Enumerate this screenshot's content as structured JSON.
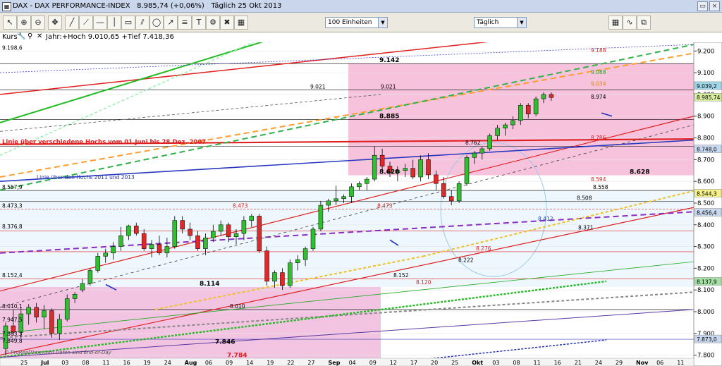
{
  "window": {
    "title": "DAX - DAX PERFORMANCE-INDEX",
    "quote": "8.985,74 (+0,06%)",
    "timeframe": "Täglich 25 Okt 2013"
  },
  "toolbar": {
    "units_select": "100 Einheiten",
    "period_select": "Täglich"
  },
  "header": {
    "series_label": "Kurs",
    "year_info": "Jahr:+Hoch 9.010,65 +Tief 7.418,36"
  },
  "chart_data": {
    "type": "candlestick",
    "ylim": [
      7750,
      9240
    ],
    "yticks": [
      "9.200",
      "9.100",
      "9.000",
      "8.900",
      "8.800",
      "8.700",
      "8.600",
      "8.500",
      "8.400",
      "8.300",
      "8.200",
      "8.100",
      "8.000",
      "7.900",
      "7.800"
    ],
    "xticks": [
      "25",
      "Jul",
      "03",
      "08",
      "11",
      "16",
      "19",
      "24",
      "Aug",
      "06",
      "09",
      "14",
      "19",
      "22",
      "27",
      "Sep",
      "04",
      "09",
      "12",
      "17",
      "20",
      "25",
      "Okt",
      "03",
      "08",
      "11",
      "16",
      "21",
      "24",
      "29",
      "Nov",
      "06",
      "11"
    ],
    "price_boxes": [
      {
        "label": "9.039,2",
        "value": 9039,
        "color": "#9fd6e8"
      },
      {
        "label": "8.985,74",
        "value": 8986,
        "color": "#d9f0a3"
      },
      {
        "label": "8.748,0",
        "value": 8748,
        "color": "#c8d8f0"
      },
      {
        "label": "8.544,3",
        "value": 8544,
        "color": "#f5f08a"
      },
      {
        "label": "8.456,4",
        "value": 8456,
        "color": "#c7d8ef"
      },
      {
        "label": "8.137,9",
        "value": 8138,
        "color": "#a6e0a6"
      },
      {
        "label": "7.873,0",
        "value": 7873,
        "color": "#c7d8ef"
      }
    ],
    "left_levels": [
      {
        "label": "9.198,6",
        "value": 9199
      },
      {
        "label": "8.557,9",
        "value": 8558
      },
      {
        "label": "8.473,3",
        "value": 8473
      },
      {
        "label": "8.376,8",
        "value": 8377
      },
      {
        "label": "8.152,4",
        "value": 8152
      },
      {
        "label": "8.010,1",
        "value": 8010
      },
      {
        "label": "7.947,5",
        "value": 7948
      },
      {
        "label": "7.883,3",
        "value": 7883
      },
      {
        "label": "7.849,8",
        "value": 7850
      }
    ],
    "level_labels": [
      {
        "label": "9.142",
        "value": 9142,
        "bold": true,
        "color": "#000"
      },
      {
        "label": "9.021",
        "value": 9021,
        "bold": false,
        "color": "#000"
      },
      {
        "label": "9.021",
        "value": 9021,
        "bold": false,
        "color": "#000"
      },
      {
        "label": "8.885",
        "value": 8885,
        "bold": true,
        "color": "#000"
      },
      {
        "label": "8.762",
        "value": 8762,
        "bold": false,
        "color": "#000"
      },
      {
        "label": "8.628",
        "value": 8628,
        "bold": true,
        "color": "#000"
      },
      {
        "label": "8.628",
        "value": 8628,
        "bold": true,
        "color": "#000"
      },
      {
        "label": "8.558",
        "value": 8558,
        "bold": false,
        "color": "#000"
      },
      {
        "label": "8.508",
        "value": 8508,
        "bold": false,
        "color": "#000"
      },
      {
        "label": "8.473",
        "value": 8473,
        "bold": false,
        "color": "#e02020"
      },
      {
        "label": "8.473",
        "value": 8473,
        "bold": false,
        "color": "#e02020"
      },
      {
        "label": "8.412",
        "value": 8412,
        "bold": false,
        "color": "#2040c0"
      },
      {
        "label": "8.371",
        "value": 8371,
        "bold": false,
        "color": "#000"
      },
      {
        "label": "8.276",
        "value": 8276,
        "bold": false,
        "color": "#e02020"
      },
      {
        "label": "8.222",
        "value": 8222,
        "bold": false,
        "color": "#000"
      },
      {
        "label": "8.152",
        "value": 8152,
        "bold": false,
        "color": "#000"
      },
      {
        "label": "8.120",
        "value": 8120,
        "bold": false,
        "color": "#e02020"
      },
      {
        "label": "8.114",
        "value": 8114,
        "bold": true,
        "color": "#000"
      },
      {
        "label": "8.010",
        "value": 8010,
        "bold": false,
        "color": "#000"
      },
      {
        "label": "7.846",
        "value": 7846,
        "bold": true,
        "color": "#000"
      },
      {
        "label": "7.784",
        "value": 7784,
        "bold": true,
        "color": "#e02020"
      },
      {
        "label": "9.188",
        "value": 9188,
        "bold": false,
        "color": "#e02020"
      },
      {
        "label": "9.088",
        "value": 9088,
        "bold": false,
        "color": "#22aa22"
      },
      {
        "label": "9.034",
        "value": 9034,
        "bold": false,
        "color": "#e08a00"
      },
      {
        "label": "8.974",
        "value": 8974,
        "bold": false,
        "color": "#000"
      },
      {
        "label": "8.786",
        "value": 8786,
        "bold": false,
        "color": "#e02020"
      },
      {
        "label": "8.594",
        "value": 8594,
        "bold": false,
        "color": "#e02020"
      }
    ],
    "annotations": [
      "Linie über verschiedene Hochs vom 01.Juni bis 28.Dez. 2007",
      "Linie über den Hochs 2011 und 2013"
    ],
    "footer_credit": "© ProRealTime.com Daten sind End-of-Day",
    "candles": [
      [
        7830,
        7950,
        7800,
        7935
      ],
      [
        7935,
        8010,
        7890,
        7905
      ],
      [
        7905,
        8020,
        7880,
        7990
      ],
      [
        7990,
        8035,
        7940,
        8020
      ],
      [
        8020,
        8040,
        7950,
        7975
      ],
      [
        7975,
        8030,
        7920,
        8005
      ],
      [
        8005,
        8015,
        7880,
        7900
      ],
      [
        7900,
        7990,
        7870,
        7965
      ],
      [
        7965,
        8080,
        7955,
        8060
      ],
      [
        8060,
        8090,
        8040,
        8080
      ],
      [
        8100,
        8150,
        8090,
        8130
      ],
      [
        8130,
        8200,
        8120,
        8190
      ],
      [
        8190,
        8270,
        8180,
        8255
      ],
      [
        8255,
        8290,
        8225,
        8270
      ],
      [
        8270,
        8320,
        8240,
        8300
      ],
      [
        8300,
        8390,
        8280,
        8350
      ],
      [
        8350,
        8400,
        8330,
        8395
      ],
      [
        8395,
        8410,
        8350,
        8360
      ],
      [
        8360,
        8380,
        8280,
        8290
      ],
      [
        8290,
        8330,
        8250,
        8310
      ],
      [
        8310,
        8350,
        8260,
        8270
      ],
      [
        8270,
        8340,
        8250,
        8300
      ],
      [
        8300,
        8440,
        8290,
        8420
      ],
      [
        8420,
        8440,
        8360,
        8380
      ],
      [
        8380,
        8410,
        8330,
        8350
      ],
      [
        8350,
        8370,
        8280,
        8290
      ],
      [
        8290,
        8360,
        8260,
        8340
      ],
      [
        8340,
        8400,
        8320,
        8370
      ],
      [
        8370,
        8420,
        8350,
        8400
      ],
      [
        8400,
        8410,
        8320,
        8345
      ],
      [
        8345,
        8380,
        8310,
        8360
      ],
      [
        8360,
        8440,
        8330,
        8420
      ],
      [
        8420,
        8450,
        8390,
        8440
      ],
      [
        8440,
        8450,
        8270,
        8280
      ],
      [
        8280,
        8300,
        8120,
        8140
      ],
      [
        8140,
        8190,
        8110,
        8180
      ],
      [
        8180,
        8200,
        8100,
        8120
      ],
      [
        8120,
        8240,
        8110,
        8225
      ],
      [
        8225,
        8260,
        8190,
        8240
      ],
      [
        8240,
        8300,
        8210,
        8290
      ],
      [
        8290,
        8390,
        8280,
        8380
      ],
      [
        8380,
        8510,
        8370,
        8490
      ],
      [
        8490,
        8520,
        8460,
        8510
      ],
      [
        8510,
        8580,
        8490,
        8520
      ],
      [
        8520,
        8540,
        8500,
        8530
      ],
      [
        8530,
        8590,
        8500,
        8575
      ],
      [
        8575,
        8600,
        8560,
        8590
      ],
      [
        8590,
        8620,
        8560,
        8610
      ],
      [
        8610,
        8760,
        8600,
        8720
      ],
      [
        8720,
        8750,
        8650,
        8670
      ],
      [
        8670,
        8690,
        8620,
        8640
      ],
      [
        8640,
        8670,
        8600,
        8650
      ],
      [
        8650,
        8680,
        8620,
        8660
      ],
      [
        8660,
        8700,
        8610,
        8620
      ],
      [
        8620,
        8720,
        8600,
        8700
      ],
      [
        8700,
        8730,
        8610,
        8630
      ],
      [
        8630,
        8650,
        8560,
        8590
      ],
      [
        8590,
        8620,
        8520,
        8530
      ],
      [
        8530,
        8560,
        8490,
        8510
      ],
      [
        8510,
        8600,
        8500,
        8590
      ],
      [
        8590,
        8720,
        8580,
        8710
      ],
      [
        8710,
        8740,
        8680,
        8730
      ],
      [
        8730,
        8760,
        8700,
        8750
      ],
      [
        8750,
        8820,
        8740,
        8810
      ],
      [
        8810,
        8860,
        8790,
        8845
      ],
      [
        8845,
        8870,
        8810,
        8860
      ],
      [
        8860,
        8900,
        8840,
        8880
      ],
      [
        8880,
        8960,
        8860,
        8950
      ],
      [
        8950,
        8960,
        8890,
        8910
      ],
      [
        8910,
        8990,
        8900,
        8980
      ],
      [
        8980,
        9010,
        8960,
        9000
      ],
      [
        9000,
        9010,
        8970,
        8986
      ]
    ]
  }
}
